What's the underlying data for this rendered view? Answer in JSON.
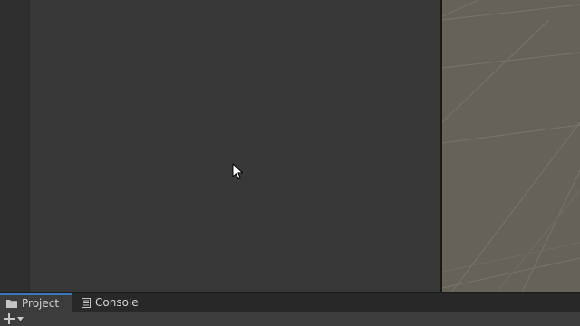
{
  "tabs": {
    "project_label": "Project",
    "console_label": "Console"
  },
  "icons": {
    "project_tab_icon": "folder-icon",
    "console_tab_icon": "console-icon",
    "add_button_icon": "plus-icon",
    "add_dropdown_icon": "chevron-down-icon",
    "cursor_icon": "mouse-cursor-icon"
  },
  "colors": {
    "panel_background": "#383838",
    "scene_background": "#666159",
    "grid_line": "#77726a",
    "active_tab_accent": "#3a79bb",
    "tab_text": "#d2d2d2"
  }
}
